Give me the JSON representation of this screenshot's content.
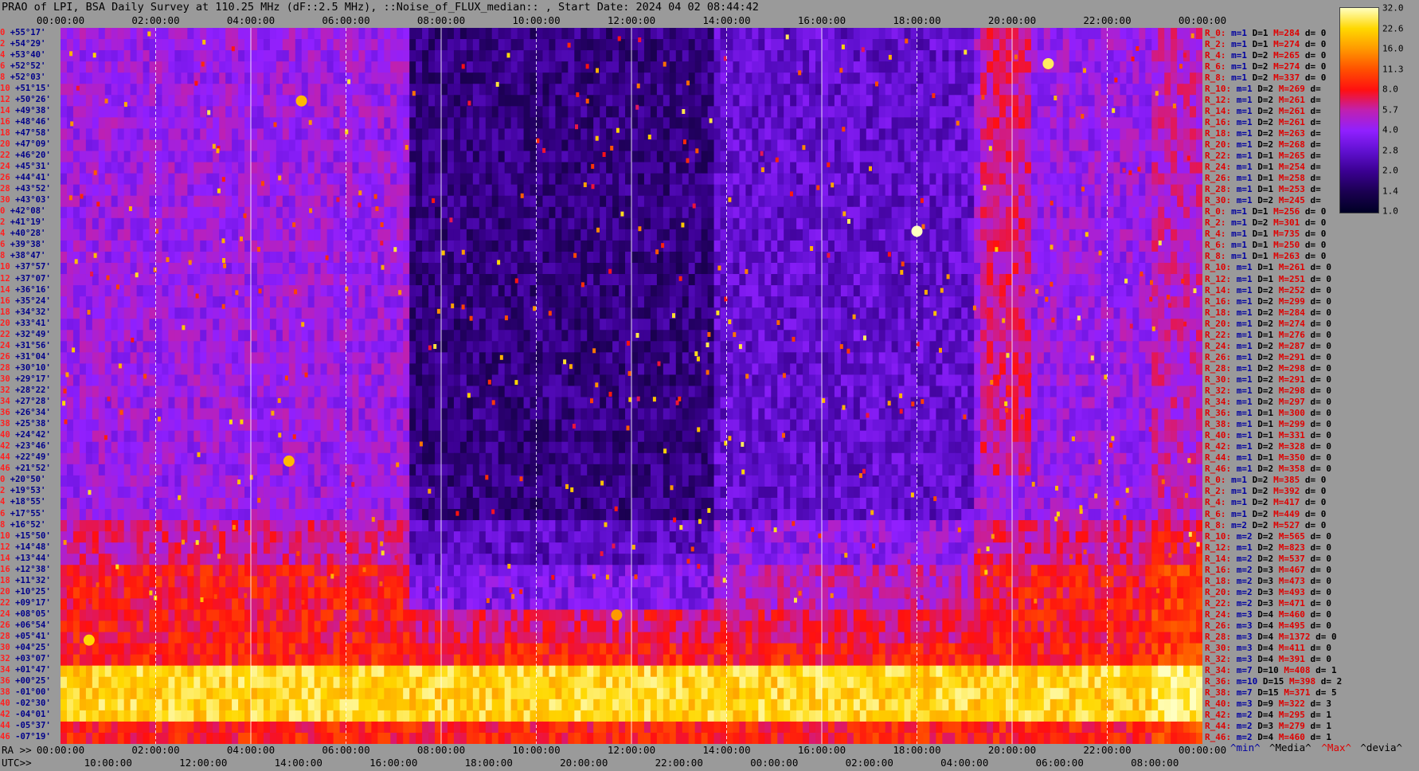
{
  "title": "PRAO of LPI, BSA Daily Survey at 110.25 MHz (dF::2.5 MHz), ::Noise_of_FLUX_median:: , Start Date: 2024 04 02 08:44:42",
  "chart_data": {
    "type": "heatmap",
    "title": "PRAO of LPI, BSA Daily Survey at 110.25 MHz (dF::2.5 MHz), ::Noise_of_FLUX_median:: , Start Date: 2024 04 02 08:44:42",
    "x_top_ticks": [
      "00:00:00",
      "02:00:00",
      "04:00:00",
      "06:00:00",
      "08:00:00",
      "10:00:00",
      "12:00:00",
      "14:00:00",
      "16:00:00",
      "18:00:00",
      "20:00:00",
      "22:00:00",
      "00:00:00"
    ],
    "x_bottom_ra_prefix": "RA >>",
    "x_bottom_ra_ticks": [
      "00:00:00",
      "02:00:00",
      "04:00:00",
      "06:00:00",
      "08:00:00",
      "10:00:00",
      "12:00:00",
      "14:00:00",
      "16:00:00",
      "18:00:00",
      "20:00:00",
      "22:00:00",
      "00:00:00"
    ],
    "x_bottom_utc_prefix": "UTC>>",
    "x_bottom_utc_ticks": [
      "10:00:00",
      "12:00:00",
      "14:00:00",
      "16:00:00",
      "18:00:00",
      "20:00:00",
      "22:00:00",
      "00:00:00",
      "02:00:00",
      "04:00:00",
      "06:00:00",
      "08:00:00"
    ],
    "y_declinations": [
      "+55°17'",
      "+54°29'",
      "+53°40'",
      "+52°52'",
      "+52°03'",
      "+51°15'",
      "+50°26'",
      "+49°38'",
      "+48°46'",
      "+47°58'",
      "+47°09'",
      "+46°20'",
      "+45°31'",
      "+44°41'",
      "+43°52'",
      "+43°03'",
      "+42°08'",
      "+41°19'",
      "+40°28'",
      "+39°38'",
      "+38°47'",
      "+37°57'",
      "+37°07'",
      "+36°16'",
      "+35°24'",
      "+34°32'",
      "+33°41'",
      "+32°49'",
      "+31°56'",
      "+31°04'",
      "+30°10'",
      "+29°17'",
      "+28°22'",
      "+27°28'",
      "+26°34'",
      "+25°38'",
      "+24°42'",
      "+23°46'",
      "+22°49'",
      "+21°52'",
      "+20°50'",
      "+19°53'",
      "+18°55'",
      "+17°55'",
      "+16°52'",
      "+15°50'",
      "+14°48'",
      "+13°44'",
      "+12°38'",
      "+11°32'",
      "+10°25'",
      "+09°17'",
      "+08°05'",
      "+06°54'",
      "+05°41'",
      "+04°25'",
      "+03°07'",
      "+01°47'",
      "+00°25'",
      "-01°00'",
      "-02°30'",
      "-04°01'",
      "-05°37'",
      "-07°19'"
    ],
    "y_indices": [
      "0",
      "2",
      "4",
      "6",
      "8",
      "10",
      "12",
      "14",
      "16",
      "18",
      "20",
      "22",
      "24",
      "26",
      "28",
      "30",
      "0",
      "2",
      "4",
      "6",
      "8",
      "10",
      "12",
      "14",
      "16",
      "18",
      "20",
      "22",
      "24",
      "26",
      "28",
      "30",
      "32",
      "34",
      "36",
      "38",
      "40",
      "42",
      "44",
      "46",
      "0",
      "2",
      "4",
      "6",
      "8",
      "10",
      "12",
      "14",
      "16",
      "18",
      "20",
      "22",
      "24",
      "26",
      "28",
      "30",
      "32",
      "34",
      "36",
      "38",
      "40",
      "42",
      "44",
      "46"
    ],
    "colorbar": {
      "ticks": [
        "32.0",
        "22.6",
        "16.0",
        "11.3",
        "8.0",
        "5.7",
        "4.0",
        "2.8",
        "2.0",
        "1.4",
        "1.0"
      ],
      "min": 1.0,
      "max": 32.0,
      "scale": "log",
      "colors": [
        "#000025",
        "#1a0050",
        "#3a0090",
        "#6010d0",
        "#9020ff",
        "#c020b0",
        "#ff1010",
        "#ff5000",
        "#ff9900",
        "#ffd800",
        "#ffffc0"
      ]
    },
    "stats": [
      {
        "r": "R_0:",
        "m": "m=1",
        "d": "D=1",
        "M": "M=284",
        "dd": "d= 0"
      },
      {
        "r": "R_2:",
        "m": "m=1",
        "d": "D=1",
        "M": "M=274",
        "dd": "d= 0"
      },
      {
        "r": "R_4:",
        "m": "m=1",
        "d": "D=2",
        "M": "M=265",
        "dd": "d= 0"
      },
      {
        "r": "R_6:",
        "m": "m=1",
        "d": "D=2",
        "M": "M=274",
        "dd": "d= 0"
      },
      {
        "r": "R_8:",
        "m": "m=1",
        "d": "D=2",
        "M": "M=337",
        "dd": "d= 0"
      },
      {
        "r": "R_10:",
        "m": "m=1",
        "d": "D=2",
        "M": "M=269",
        "dd": "d="
      },
      {
        "r": "R_12:",
        "m": "m=1",
        "d": "D=2",
        "M": "M=261",
        "dd": "d="
      },
      {
        "r": "R_14:",
        "m": "m=1",
        "d": "D=2",
        "M": "M=261",
        "dd": "d="
      },
      {
        "r": "R_16:",
        "m": "m=1",
        "d": "D=2",
        "M": "M=261",
        "dd": "d="
      },
      {
        "r": "R_18:",
        "m": "m=1",
        "d": "D=2",
        "M": "M=263",
        "dd": "d="
      },
      {
        "r": "R_20:",
        "m": "m=1",
        "d": "D=2",
        "M": "M=268",
        "dd": "d="
      },
      {
        "r": "R_22:",
        "m": "m=1",
        "d": "D=1",
        "M": "M=265",
        "dd": "d="
      },
      {
        "r": "R_24:",
        "m": "m=1",
        "d": "D=1",
        "M": "M=254",
        "dd": "d="
      },
      {
        "r": "R_26:",
        "m": "m=1",
        "d": "D=1",
        "M": "M=258",
        "dd": "d="
      },
      {
        "r": "R_28:",
        "m": "m=1",
        "d": "D=1",
        "M": "M=253",
        "dd": "d="
      },
      {
        "r": "R_30:",
        "m": "m=1",
        "d": "D=2",
        "M": "M=245",
        "dd": "d="
      },
      {
        "r": "R_0:",
        "m": "m=1",
        "d": "D=1",
        "M": "M=256",
        "dd": "d= 0"
      },
      {
        "r": "R_2:",
        "m": "m=1",
        "d": "D=2",
        "M": "M=301",
        "dd": "d= 0"
      },
      {
        "r": "R_4:",
        "m": "m=1",
        "d": "D=1",
        "M": "M=735",
        "dd": "d= 0"
      },
      {
        "r": "R_6:",
        "m": "m=1",
        "d": "D=1",
        "M": "M=250",
        "dd": "d= 0"
      },
      {
        "r": "R_8:",
        "m": "m=1",
        "d": "D=1",
        "M": "M=263",
        "dd": "d= 0"
      },
      {
        "r": "R_10:",
        "m": "m=1",
        "d": "D=1",
        "M": "M=261",
        "dd": "d= 0"
      },
      {
        "r": "R_12:",
        "m": "m=1",
        "d": "D=1",
        "M": "M=251",
        "dd": "d= 0"
      },
      {
        "r": "R_14:",
        "m": "m=1",
        "d": "D=2",
        "M": "M=252",
        "dd": "d= 0"
      },
      {
        "r": "R_16:",
        "m": "m=1",
        "d": "D=2",
        "M": "M=299",
        "dd": "d= 0"
      },
      {
        "r": "R_18:",
        "m": "m=1",
        "d": "D=2",
        "M": "M=284",
        "dd": "d= 0"
      },
      {
        "r": "R_20:",
        "m": "m=1",
        "d": "D=2",
        "M": "M=274",
        "dd": "d= 0"
      },
      {
        "r": "R_22:",
        "m": "m=1",
        "d": "D=1",
        "M": "M=276",
        "dd": "d= 0"
      },
      {
        "r": "R_24:",
        "m": "m=1",
        "d": "D=2",
        "M": "M=287",
        "dd": "d= 0"
      },
      {
        "r": "R_26:",
        "m": "m=1",
        "d": "D=2",
        "M": "M=291",
        "dd": "d= 0"
      },
      {
        "r": "R_28:",
        "m": "m=1",
        "d": "D=2",
        "M": "M=298",
        "dd": "d= 0"
      },
      {
        "r": "R_30:",
        "m": "m=1",
        "d": "D=2",
        "M": "M=291",
        "dd": "d= 0"
      },
      {
        "r": "R_32:",
        "m": "m=1",
        "d": "D=2",
        "M": "M=298",
        "dd": "d= 0"
      },
      {
        "r": "R_34:",
        "m": "m=1",
        "d": "D=2",
        "M": "M=297",
        "dd": "d= 0"
      },
      {
        "r": "R_36:",
        "m": "m=1",
        "d": "D=1",
        "M": "M=300",
        "dd": "d= 0"
      },
      {
        "r": "R_38:",
        "m": "m=1",
        "d": "D=1",
        "M": "M=299",
        "dd": "d= 0"
      },
      {
        "r": "R_40:",
        "m": "m=1",
        "d": "D=1",
        "M": "M=331",
        "dd": "d= 0"
      },
      {
        "r": "R_42:",
        "m": "m=1",
        "d": "D=2",
        "M": "M=328",
        "dd": "d= 0"
      },
      {
        "r": "R_44:",
        "m": "m=1",
        "d": "D=1",
        "M": "M=350",
        "dd": "d= 0"
      },
      {
        "r": "R_46:",
        "m": "m=1",
        "d": "D=2",
        "M": "M=358",
        "dd": "d= 0"
      },
      {
        "r": "R_0:",
        "m": "m=1",
        "d": "D=2",
        "M": "M=385",
        "dd": "d= 0"
      },
      {
        "r": "R_2:",
        "m": "m=1",
        "d": "D=2",
        "M": "M=392",
        "dd": "d= 0"
      },
      {
        "r": "R_4:",
        "m": "m=1",
        "d": "D=2",
        "M": "M=417",
        "dd": "d= 0"
      },
      {
        "r": "R_6:",
        "m": "m=1",
        "d": "D=2",
        "M": "M=449",
        "dd": "d= 0"
      },
      {
        "r": "R_8:",
        "m": "m=2",
        "d": "D=2",
        "M": "M=527",
        "dd": "d= 0"
      },
      {
        "r": "R_10:",
        "m": "m=2",
        "d": "D=2",
        "M": "M=565",
        "dd": "d= 0"
      },
      {
        "r": "R_12:",
        "m": "m=1",
        "d": "D=2",
        "M": "M=823",
        "dd": "d= 0"
      },
      {
        "r": "R_14:",
        "m": "m=2",
        "d": "D=2",
        "M": "M=537",
        "dd": "d= 0"
      },
      {
        "r": "R_16:",
        "m": "m=2",
        "d": "D=3",
        "M": "M=467",
        "dd": "d= 0"
      },
      {
        "r": "R_18:",
        "m": "m=2",
        "d": "D=3",
        "M": "M=473",
        "dd": "d= 0"
      },
      {
        "r": "R_20:",
        "m": "m=2",
        "d": "D=3",
        "M": "M=493",
        "dd": "d= 0"
      },
      {
        "r": "R_22:",
        "m": "m=2",
        "d": "D=3",
        "M": "M=471",
        "dd": "d= 0"
      },
      {
        "r": "R_24:",
        "m": "m=3",
        "d": "D=4",
        "M": "M=460",
        "dd": "d= 0"
      },
      {
        "r": "R_26:",
        "m": "m=3",
        "d": "D=4",
        "M": "M=495",
        "dd": "d= 0"
      },
      {
        "r": "R_28:",
        "m": "m=3",
        "d": "D=4",
        "M": "M=1372",
        "dd": "d= 0"
      },
      {
        "r": "R_30:",
        "m": "m=3",
        "d": "D=4",
        "M": "M=411",
        "dd": "d= 0"
      },
      {
        "r": "R_32:",
        "m": "m=3",
        "d": "D=4",
        "M": "M=391",
        "dd": "d= 0"
      },
      {
        "r": "R_34:",
        "m": "m=7",
        "d": "D=10",
        "M": "M=408",
        "dd": "d= 1"
      },
      {
        "r": "R_36:",
        "m": "m=10",
        "d": "D=15",
        "M": "M=398",
        "dd": "d= 2"
      },
      {
        "r": "R_38:",
        "m": "m=7",
        "d": "D=15",
        "M": "M=371",
        "dd": "d= 5"
      },
      {
        "r": "R_40:",
        "m": "m=3",
        "d": "D=9",
        "M": "M=322",
        "dd": "d= 3"
      },
      {
        "r": "R_42:",
        "m": "m=2",
        "d": "D=4",
        "M": "M=295",
        "dd": "d= 1"
      },
      {
        "r": "R_44:",
        "m": "m=2",
        "d": "D=3",
        "M": "M=279",
        "dd": "d= 1"
      },
      {
        "r": "R_46:",
        "m": "m=2",
        "d": "D=4",
        "M": "M=460",
        "dd": "d= 1"
      }
    ],
    "legend": [
      "^min^",
      "^Media^",
      "^Max^",
      "^devia^"
    ]
  }
}
